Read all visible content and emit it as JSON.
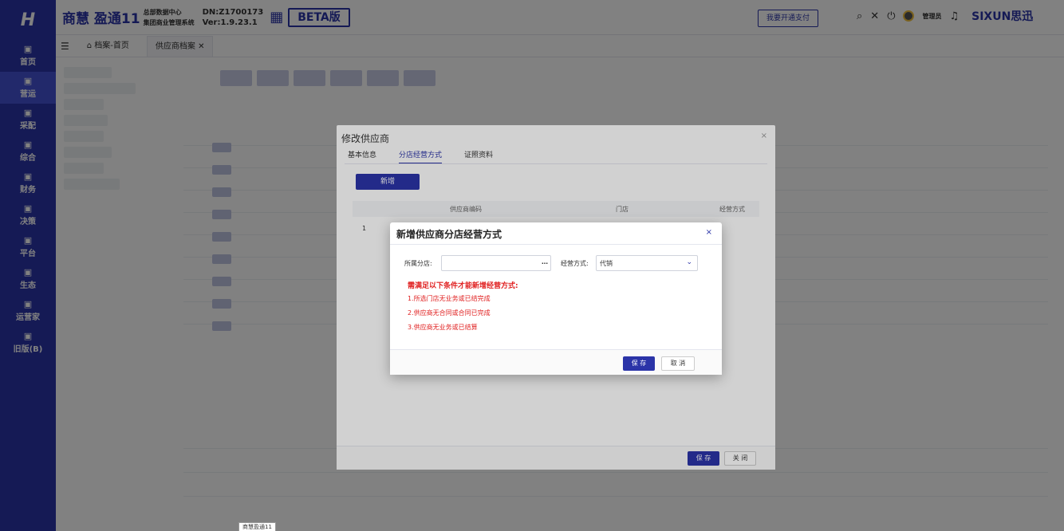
{
  "app": {
    "brand": "商慧 盈通11",
    "brand_sub_line1": "总部数据中心",
    "brand_sub_line2": "集团商业管理系统",
    "dn": "DN:Z1700173",
    "version": "Ver:1.9.23.1",
    "beta": "BETA版",
    "pay_button": "我要开通支付",
    "admin": "管理员",
    "company": "SIXUN思迅",
    "tooltip": "商慧盈通11"
  },
  "sidebar": {
    "items": [
      {
        "label": "首页",
        "icon": "home-icon"
      },
      {
        "label": "营运",
        "icon": "operations-icon"
      },
      {
        "label": "采配",
        "icon": "purchase-icon"
      },
      {
        "label": "综合",
        "icon": "general-icon"
      },
      {
        "label": "财务",
        "icon": "finance-icon"
      },
      {
        "label": "决策",
        "icon": "decision-icon"
      },
      {
        "label": "平台",
        "icon": "platform-icon"
      },
      {
        "label": "生态",
        "icon": "ecosystem-icon"
      },
      {
        "label": "运营家",
        "icon": "operator-icon"
      },
      {
        "label": "旧版(B)",
        "icon": "legacy-icon"
      }
    ],
    "active_index": 1
  },
  "tabs": {
    "home": "档案-首页",
    "active": "供应商档案"
  },
  "modal_edit": {
    "title": "修改供应商",
    "tabs": [
      "基本信息",
      "分店经营方式",
      "证照资料"
    ],
    "add_button": "新增",
    "columns": [
      "供应商编码",
      "门店",
      "经营方式"
    ],
    "row": {
      "index": "1"
    },
    "save": "保 存",
    "close": "关 闭"
  },
  "dialog": {
    "title": "新增供应商分店经营方式",
    "close": "×",
    "branch_label": "所属分店:",
    "branch_value": "",
    "mode_label": "经营方式:",
    "mode_value": "代销",
    "warning_title": "需满足以下条件才能新增经营方式:",
    "conditions": [
      "1.所选门店无业务或已结完成",
      "2.供应商无合同或合同已完成",
      "3.供应商无业务或已结算"
    ],
    "save": "保 存",
    "cancel": "取 消"
  },
  "colors": {
    "primary": "#2b34a8",
    "warning": "#e02020"
  }
}
